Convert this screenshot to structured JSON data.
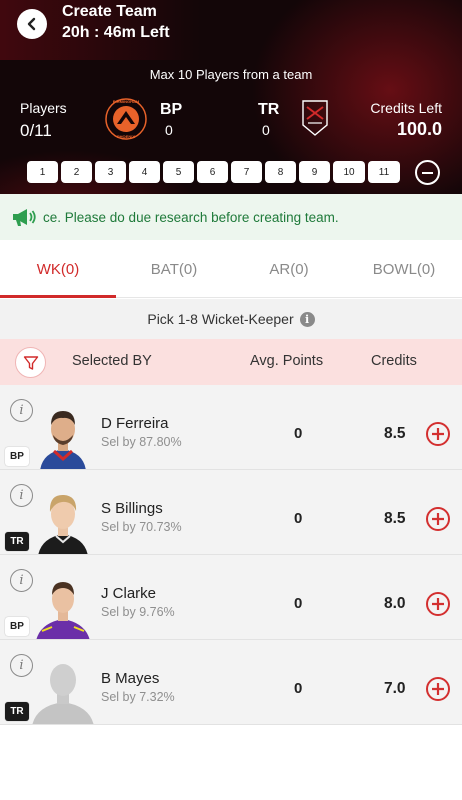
{
  "header": {
    "title": "Create Team",
    "time_left": "20h : 46m Left",
    "max_note": "Max 10 Players from  a team",
    "players_label": "Players",
    "players_value": "0/11",
    "team1": {
      "code": "BP",
      "count": "0",
      "logo_text": "BIRMINGHAM PHOENIX",
      "color": "#e8622a"
    },
    "team2": {
      "code": "TR",
      "count": "0"
    },
    "credits_label": "Credits Left",
    "credits_value": "100.0",
    "slots": [
      "1",
      "2",
      "3",
      "4",
      "5",
      "6",
      "7",
      "8",
      "9",
      "10",
      "11"
    ]
  },
  "notice": {
    "text": "ce. Please do due research before creating team.",
    "color": "#1f7a3a"
  },
  "tabs": [
    {
      "label": "WK(0)",
      "active": true
    },
    {
      "label": "BAT(0)",
      "active": false
    },
    {
      "label": "AR(0)",
      "active": false
    },
    {
      "label": "BOWL(0)",
      "active": false
    }
  ],
  "pick_note": "Pick 1-8 Wicket-Keeper",
  "columns": {
    "selected_by": "Selected BY",
    "avg_points": "Avg. Points",
    "credits": "Credits"
  },
  "players": [
    {
      "name": "D Ferreira",
      "sel": "Sel by 87.80%",
      "points": "0",
      "credits": "8.5",
      "team": "BP",
      "jersey": "#2a4a9a"
    },
    {
      "name": "S Billings",
      "sel": "Sel by 70.73%",
      "points": "0",
      "credits": "8.5",
      "team": "TR",
      "jersey": "#1c1c1c"
    },
    {
      "name": "J Clarke",
      "sel": "Sel by 9.76%",
      "points": "0",
      "credits": "8.0",
      "team": "BP",
      "jersey": "#6b2fa8"
    },
    {
      "name": "B Mayes",
      "sel": "Sel by 7.32%",
      "points": "0",
      "credits": "7.0",
      "team": "TR",
      "jersey": "#c4c4c4"
    }
  ],
  "colors": {
    "accent": "#d12a2a",
    "header_bg": "#130608",
    "column_header_bg": "#fbe0df"
  }
}
